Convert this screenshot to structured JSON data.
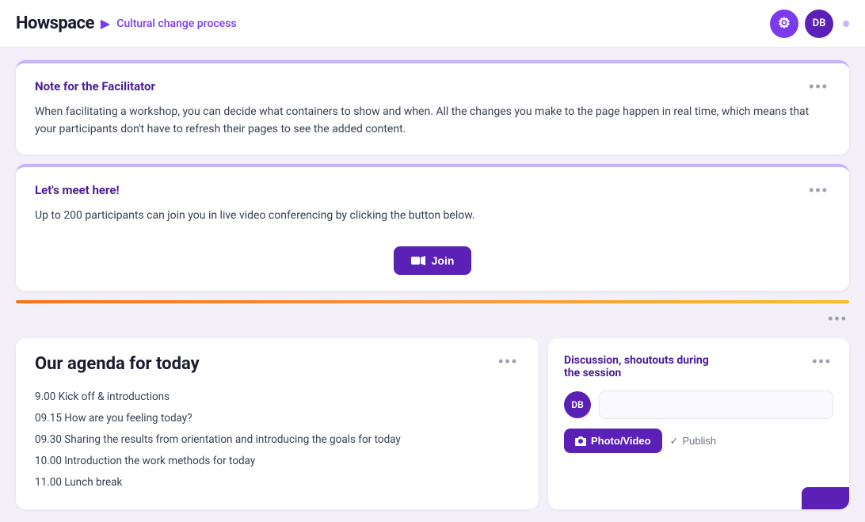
{
  "header": {
    "logo": "Howspace",
    "breadcrumb_sep": "▶",
    "breadcrumb": "Cultural change process",
    "avatars": [
      {
        "initials": "○",
        "type": "icon",
        "bg": "#7c3aed"
      },
      {
        "initials": "DB",
        "type": "user",
        "bg": "#5b21b6"
      }
    ]
  },
  "facilitator_card": {
    "title": "Note for the Facilitator",
    "more_label": "•••",
    "body": "When facilitating a workshop, you can decide what containers to show and when. All the changes you make to the page happen in real time, which means that your participants don't have to refresh their pages to see the added content."
  },
  "meet_card": {
    "title": "Let's meet here!",
    "more_label": "•••",
    "body": "Up to 200 participants can join you in live video conferencing by clicking the button below.",
    "join_label": "Join"
  },
  "separator_more": "•••",
  "agenda_card": {
    "title": "Our agenda for today",
    "more_label": "•••",
    "items": [
      "9.00 Kick off & introductions",
      "09.15 How are you feeling today?",
      "09.30 Sharing the results from orientation and introducing the goals for today",
      "10.00 Introduction the work methods for today",
      "11.00 Lunch break"
    ]
  },
  "discussion_card": {
    "title": "Discussion, shoutouts during the session",
    "more_label": "•••",
    "avatar_initials": "DB",
    "photo_btn_label": "Photo/Video",
    "publish_label": "Publish",
    "camera_icon": "📷"
  }
}
